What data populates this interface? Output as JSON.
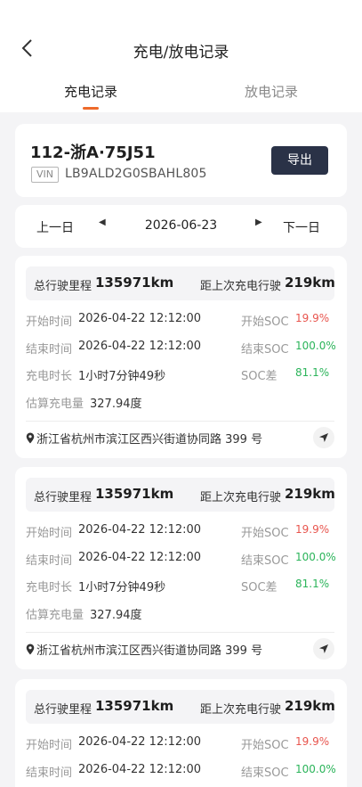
{
  "header": {
    "title": "充电/放电记录",
    "tabs": {
      "charge": "充电记录",
      "discharge": "放电记录"
    },
    "accent_color": "#ee6a2a"
  },
  "vehicle": {
    "plate": "112-浙A·75J51",
    "vin_tag": "VIN",
    "vin": "LB9ALD2G0SBAHL805",
    "export_label": "导出"
  },
  "date_nav": {
    "prev_label": "上一日",
    "next_label": "下一日",
    "date": "2026-06-23"
  },
  "records": [
    {
      "total_mileage_label": "总行驶里程",
      "total_mileage": "135971km",
      "since_last_label": "距上次充电行驶",
      "since_last": "219km",
      "start_time_label": "开始时间",
      "start_time": "2026-04-22 12:12:00",
      "start_soc_label": "开始SOC",
      "start_soc": "19.9%",
      "end_time_label": "结束时间",
      "end_time": "2026-04-22 12:12:00",
      "end_soc_label": "结束SOC",
      "end_soc": "100.0%",
      "duration_label": "充电时长",
      "duration": "1小时7分钟49秒",
      "soc_diff_label": "SOC差",
      "soc_diff": "81.1%",
      "estimated_label": "估算充电量",
      "estimated": "327.94度",
      "address": "浙江省杭州市滨江区西兴街道协同路 399 号"
    },
    {
      "total_mileage_label": "总行驶里程",
      "total_mileage": "135971km",
      "since_last_label": "距上次充电行驶",
      "since_last": "219km",
      "start_time_label": "开始时间",
      "start_time": "2026-04-22 12:12:00",
      "start_soc_label": "开始SOC",
      "start_soc": "19.9%",
      "end_time_label": "结束时间",
      "end_time": "2026-04-22 12:12:00",
      "end_soc_label": "结束SOC",
      "end_soc": "100.0%",
      "duration_label": "充电时长",
      "duration": "1小时7分钟49秒",
      "soc_diff_label": "SOC差",
      "soc_diff": "81.1%",
      "estimated_label": "估算充电量",
      "estimated": "327.94度",
      "address": "浙江省杭州市滨江区西兴街道协同路 399 号"
    },
    {
      "total_mileage_label": "总行驶里程",
      "total_mileage": "135971km",
      "since_last_label": "距上次充电行驶",
      "since_last": "219km",
      "start_time_label": "开始时间",
      "start_time": "2026-04-22 12:12:00",
      "start_soc_label": "开始SOC",
      "start_soc": "19.9%",
      "end_time_label": "结束时间",
      "end_time": "2026-04-22 12:12:00",
      "end_soc_label": "结束SOC",
      "end_soc": "100.0%"
    }
  ]
}
